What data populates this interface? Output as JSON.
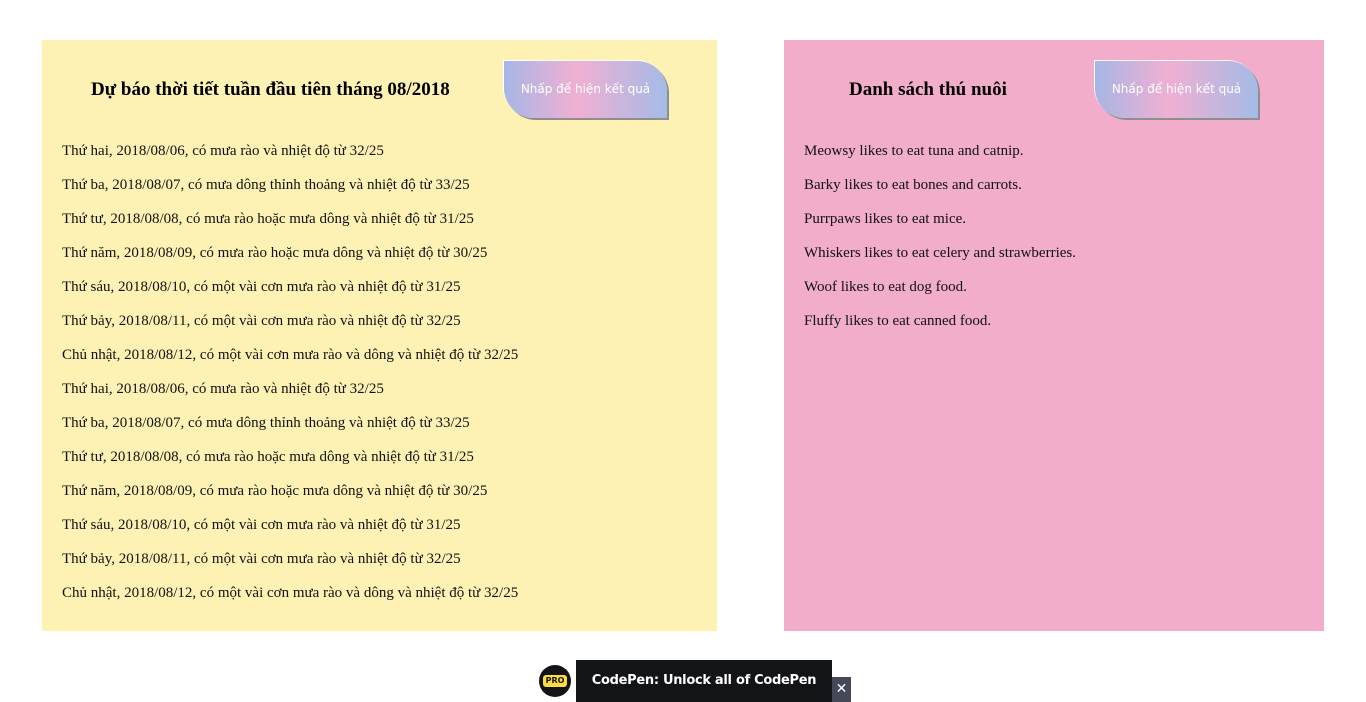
{
  "weather": {
    "title": "Dự báo thời tiết tuần đầu tiên tháng 08/2018",
    "button_label": "Nhấp để hiện kết quả",
    "background": "#fdf1b3",
    "items": [
      "Thứ hai, 2018/08/06, có mưa rào và nhiệt độ từ 32/25",
      "Thứ ba, 2018/08/07, có mưa dông thỉnh thoảng và nhiệt độ từ 33/25",
      "Thứ tư, 2018/08/08, có mưa rào hoặc mưa dông và nhiệt độ từ 31/25",
      "Thứ năm, 2018/08/09, có mưa rào hoặc mưa dông và nhiệt độ từ 30/25",
      "Thứ sáu, 2018/08/10, có một vài cơn mưa rào và nhiệt độ từ 31/25",
      "Thứ bảy, 2018/08/11, có một vài cơn mưa rào và nhiệt độ từ 32/25",
      "Chủ nhật, 2018/08/12, có một vài cơn mưa rào và dông và nhiệt độ từ 32/25",
      "Thứ hai, 2018/08/06, có mưa rào và nhiệt độ từ 32/25",
      "Thứ ba, 2018/08/07, có mưa dông thỉnh thoảng và nhiệt độ từ 33/25",
      "Thứ tư, 2018/08/08, có mưa rào hoặc mưa dông và nhiệt độ từ 31/25",
      "Thứ năm, 2018/08/09, có mưa rào hoặc mưa dông và nhiệt độ từ 30/25",
      "Thứ sáu, 2018/08/10, có một vài cơn mưa rào và nhiệt độ từ 31/25",
      "Thứ bảy, 2018/08/11, có một vài cơn mưa rào và nhiệt độ từ 32/25",
      "Chủ nhật, 2018/08/12, có một vài cơn mưa rào và dông và nhiệt độ từ 32/25"
    ]
  },
  "pets": {
    "title": "Danh sách thú nuôi",
    "button_label": "Nhấp để hiện kết quả",
    "background": "#f1adc9",
    "items": [
      "Meowsy likes to eat tuna and catnip.",
      "Barky likes to eat bones and carrots.",
      "Purrpaws likes to eat mice.",
      "Whiskers likes to eat celery and strawberries.",
      "Woof likes to eat dog food.",
      "Fluffy likes to eat canned food."
    ]
  },
  "promo": {
    "badge_label": "PRO",
    "text": "CodePen: Unlock all of CodePen",
    "close_label": "✕",
    "badge_color": "#ffdd40",
    "bar_color": "#131417"
  }
}
